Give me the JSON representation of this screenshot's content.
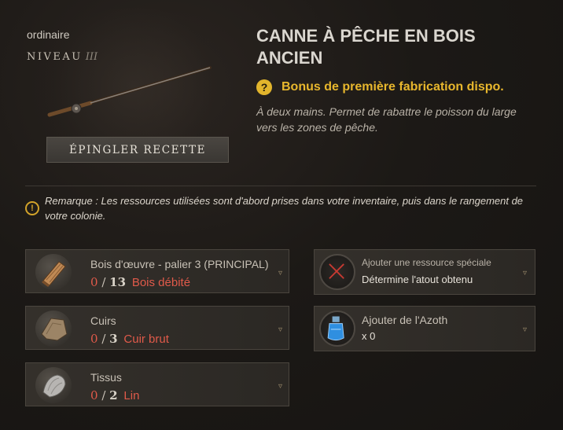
{
  "item": {
    "rarity": "ordinaire",
    "level_label": "NIVEAU",
    "level_value": "III",
    "pin_button": "ÉPINGLER RECETTE",
    "title": "CANNE À PÊCHE EN BOIS ANCIEN",
    "bonus_text": "Bonus de première fabrication dispo.",
    "description": "À deux mains. Permet de rabattre le poisson du large vers les zones de pêche."
  },
  "remark": "Remarque : Les ressources utilisées sont d'abord prises dans votre inventaire, puis dans le rangement de votre colonie.",
  "ingredients": [
    {
      "name": "Bois d'œuvre - palier 3 (PRINCIPAL)",
      "have": "0",
      "sep": "/",
      "need": "13",
      "material": "Bois débité",
      "icon": "timber-icon"
    },
    {
      "name": "Cuirs",
      "have": "0",
      "sep": "/",
      "need": "3",
      "material": "Cuir brut",
      "icon": "leather-icon"
    },
    {
      "name": "Tissus",
      "have": "0",
      "sep": "/",
      "need": "2",
      "material": "Lin",
      "icon": "cloth-icon"
    }
  ],
  "special": {
    "title": "Ajouter une ressource spéciale",
    "subtitle": "Détermine l'atout obtenu",
    "icon": "empty-slot-x-icon"
  },
  "azoth": {
    "title": "Ajouter de l'Azoth",
    "count": "x 0",
    "icon": "azoth-flask-icon"
  },
  "colors": {
    "accent_gold": "#e8b72d",
    "missing_red": "#e05a4a"
  }
}
